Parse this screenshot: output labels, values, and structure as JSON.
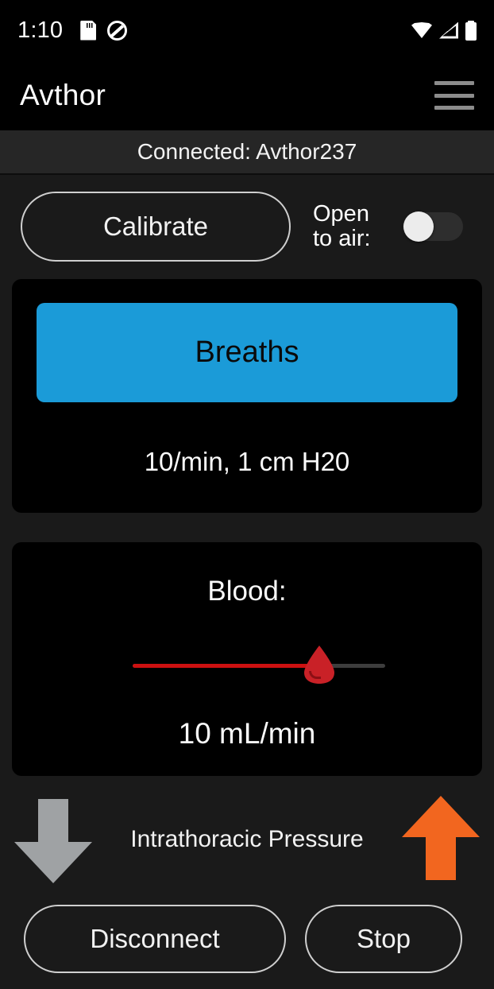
{
  "status_bar": {
    "time": "1:10",
    "left_icons": [
      "sd-card-icon",
      "do-not-disturb-icon"
    ],
    "right_icons": [
      "wifi-icon",
      "cellular-signal-icon",
      "battery-icon"
    ]
  },
  "app_bar": {
    "title": "Avthor",
    "menu_icon": "hamburger-menu-icon"
  },
  "connection": {
    "status_text": "Connected: Avthor237"
  },
  "controls": {
    "calibrate_label": "Calibrate",
    "open_to_air_label": "Open\nto air:",
    "open_to_air_line1": "Open",
    "open_to_air_line2": "to air:",
    "open_to_air_state": "off"
  },
  "breaths_card": {
    "button_label": "Breaths",
    "button_color": "#1b9bd8",
    "settings_text": "10/min, 1 cm H20"
  },
  "blood_card": {
    "title": "Blood:",
    "value_text": "10 mL/min",
    "slider": {
      "thumb_icon": "blood-drop-icon",
      "fill_color": "#cc1111",
      "track_color": "#3d3d3d",
      "percent": 74
    }
  },
  "pressure": {
    "label": "Intrathoracic Pressure",
    "down_arrow_icon": "arrow-down-icon",
    "down_arrow_color": "#9fa2a4",
    "up_arrow_icon": "arrow-up-icon",
    "up_arrow_color": "#f2661f"
  },
  "footer": {
    "disconnect_label": "Disconnect",
    "stop_label": "Stop"
  }
}
